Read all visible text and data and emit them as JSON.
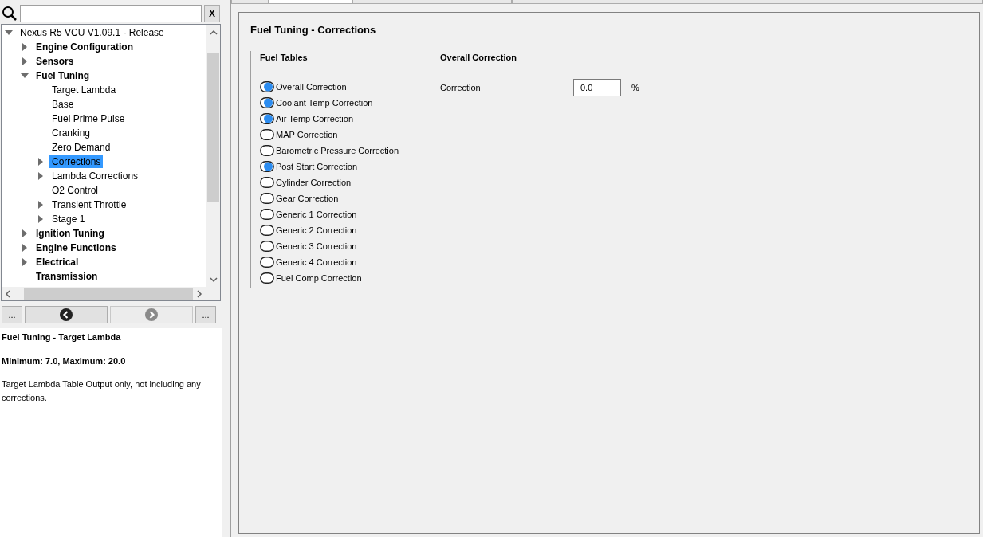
{
  "search": {
    "clear_label": "X"
  },
  "tree": [
    {
      "label": "Nexus R5 VCU V1.09.1 - Release",
      "expanded": true,
      "selected": false,
      "children": [
        {
          "label": "Engine Configuration",
          "expanded": false,
          "selected": false
        },
        {
          "label": "Sensors",
          "expanded": false,
          "selected": false
        },
        {
          "label": "Fuel Tuning",
          "expanded": true,
          "selected": false,
          "children": [
            {
              "label": "Target Lambda",
              "selected": false
            },
            {
              "label": "Base",
              "selected": false
            },
            {
              "label": "Fuel Prime Pulse",
              "selected": false
            },
            {
              "label": "Cranking",
              "selected": false
            },
            {
              "label": "Zero Demand",
              "selected": false
            },
            {
              "label": "Corrections",
              "expanded": false,
              "selected": true
            },
            {
              "label": "Lambda Corrections",
              "expanded": false,
              "selected": false
            },
            {
              "label": "O2 Control",
              "selected": false
            },
            {
              "label": "Transient Throttle",
              "expanded": false,
              "selected": false
            },
            {
              "label": "Stage 1",
              "expanded": false,
              "selected": false
            }
          ]
        },
        {
          "label": "Ignition Tuning",
          "expanded": false,
          "selected": false
        },
        {
          "label": "Engine Functions",
          "expanded": false,
          "selected": false
        },
        {
          "label": "Electrical",
          "expanded": false,
          "selected": false
        },
        {
          "label": "Transmission",
          "selected": false
        }
      ]
    }
  ],
  "nav_buttons": [
    {
      "kind": "more",
      "label": "..."
    },
    {
      "kind": "back",
      "disabled": false
    },
    {
      "kind": "forward",
      "disabled": true
    },
    {
      "kind": "more",
      "label": "..."
    }
  ],
  "info": {
    "title": "Fuel Tuning - Target Lambda",
    "range": "Minimum: 7.0, Maximum: 20.0",
    "description": "Target Lambda Table Output only, not including any corrections."
  },
  "panel": {
    "title": "Fuel Tuning - Corrections",
    "tables_heading": "Fuel Tables",
    "tables": [
      {
        "label": "Overall Correction",
        "on": true
      },
      {
        "label": "Coolant Temp Correction",
        "on": true
      },
      {
        "label": "Air Temp Correction",
        "on": true
      },
      {
        "label": "MAP Correction",
        "on": false
      },
      {
        "label": "Barometric Pressure Correction",
        "on": false
      },
      {
        "label": "Post Start Correction",
        "on": true
      },
      {
        "label": "Cylinder Correction",
        "on": false
      },
      {
        "label": "Gear Correction",
        "on": false
      },
      {
        "label": "Generic 1 Correction",
        "on": false
      },
      {
        "label": "Generic 2 Correction",
        "on": false
      },
      {
        "label": "Generic 3 Correction",
        "on": false
      },
      {
        "label": "Generic 4 Correction",
        "on": false
      },
      {
        "label": "Fuel Comp Correction",
        "on": false
      }
    ],
    "detail_heading": "Overall Correction",
    "fields": [
      {
        "label": "Correction",
        "value": "0.0",
        "unit": "%"
      }
    ]
  }
}
